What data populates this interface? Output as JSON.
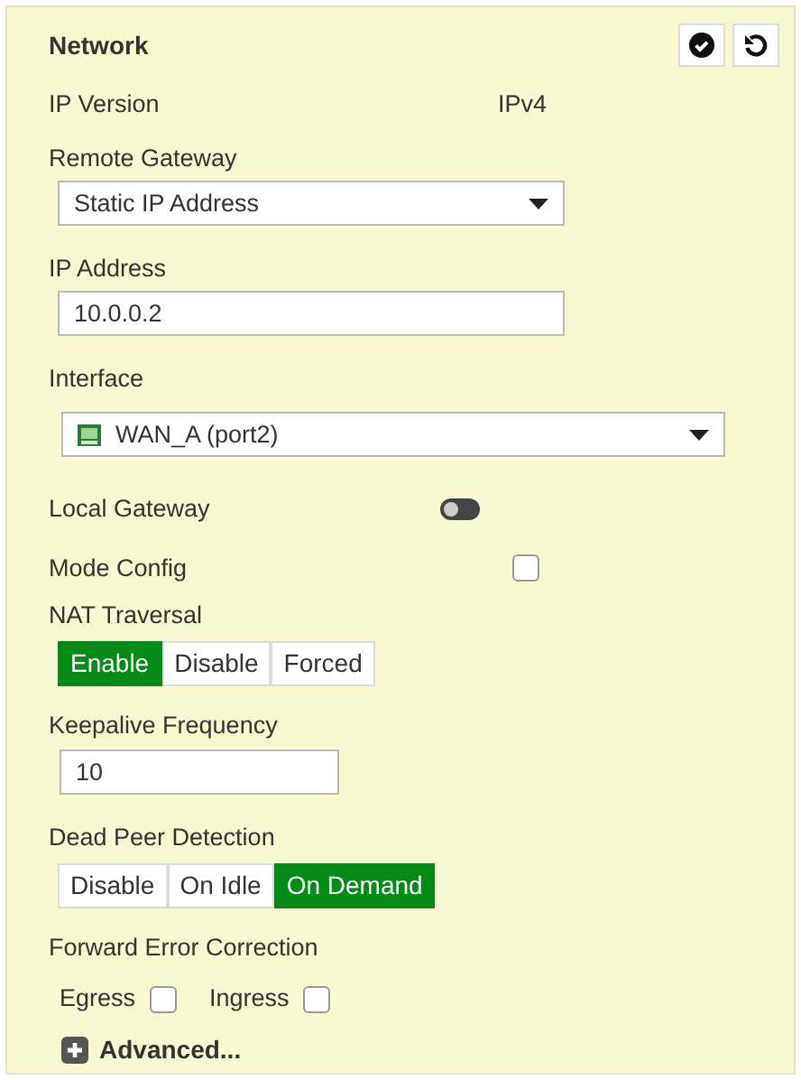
{
  "panel": {
    "title": "Network"
  },
  "fields": [
    {
      "kind": "text",
      "label": "IP Version",
      "value": "IPv4"
    },
    {
      "kind": "select",
      "label": "Remote Gateway",
      "value": "Static IP Address"
    },
    {
      "kind": "input",
      "label": "IP Address",
      "value": "10.0.0.2"
    },
    {
      "kind": "interface",
      "label": "Interface",
      "value": "WAN_A (port2)"
    },
    {
      "kind": "toggle",
      "label": "Local Gateway",
      "on": false
    },
    {
      "kind": "checkbox",
      "label": "Mode Config",
      "checked": false
    },
    {
      "kind": "segmented",
      "label": "NAT Traversal",
      "options": [
        {
          "label": "Enable",
          "selected": true
        },
        {
          "label": "Disable",
          "selected": false
        },
        {
          "label": "Forced",
          "selected": false
        }
      ]
    },
    {
      "kind": "short-input",
      "label": "Keepalive Frequency",
      "value": "10"
    },
    {
      "kind": "segmented",
      "label": "Dead Peer Detection",
      "options": [
        {
          "label": "Disable",
          "selected": false
        },
        {
          "label": "On Idle",
          "selected": false
        },
        {
          "label": "On Demand",
          "selected": true
        }
      ]
    },
    {
      "kind": "checks",
      "label": "Forward Error Correction",
      "options": [
        {
          "label": "Egress",
          "checked": false
        },
        {
          "label": "Ingress",
          "checked": false
        }
      ]
    }
  ],
  "advanced": {
    "label": "Advanced...",
    "expanded": false
  }
}
